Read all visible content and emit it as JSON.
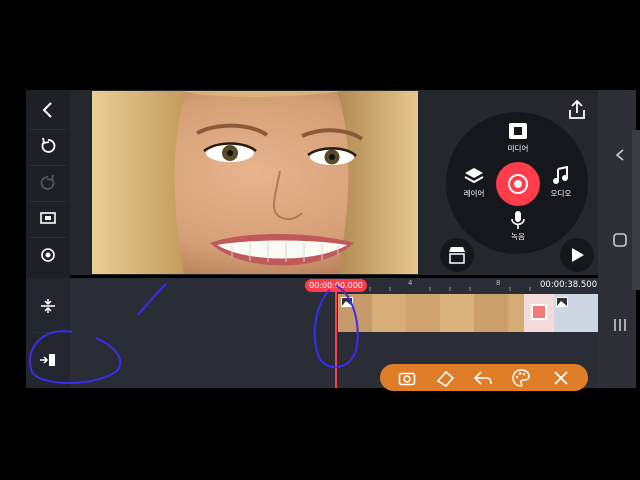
{
  "timeline": {
    "current_time": "00:00:00.000",
    "total_time": "00:00:38.500",
    "ruler_marks": [
      "4",
      "8"
    ]
  },
  "wheel": {
    "media_label": "미디어",
    "layer_label": "레이어",
    "audio_label": "오디오",
    "voice_label": "녹음"
  },
  "left_toolbar": {
    "icons": [
      "back-icon",
      "undo-icon",
      "redo-icon",
      "crop-icon",
      "settings-icon",
      "adjust-icon",
      "import-icon"
    ]
  },
  "bottom_toolbar": {
    "icons": [
      "camera-icon",
      "eraser-icon",
      "undo-arrow-icon",
      "palette-icon",
      "close-icon"
    ]
  },
  "colors": {
    "accent": "#ff3c4b",
    "toolbar": "#e07d28",
    "panel": "#24272e"
  }
}
